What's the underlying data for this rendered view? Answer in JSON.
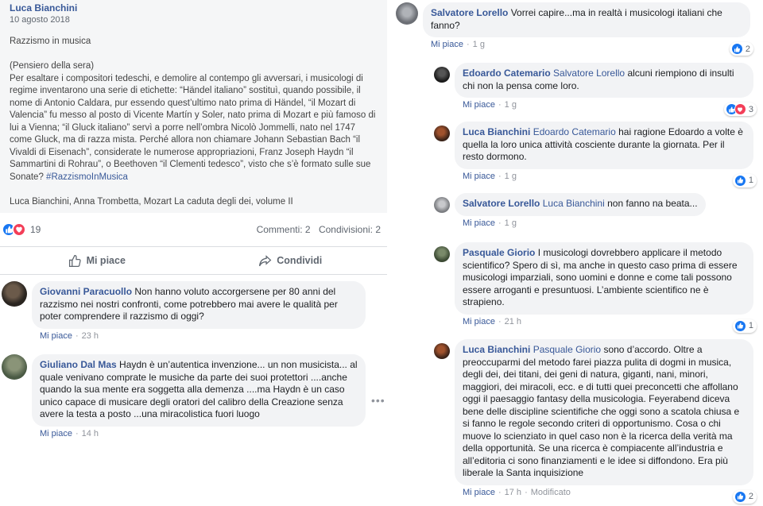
{
  "post": {
    "author": "Luca Bianchini",
    "date": "10 agosto 2018",
    "body": "Razzismo in musica\n\n(Pensiero della sera)\nPer esaltare i compositori tedeschi, e demolire al contempo gli avversari, i musicologi di regime inventarono una serie di etichette: “Händel italiano” sostituì, quando possibile, il nome di Antonio Caldara, pur essendo quest’ultimo nato prima di Händel, “il Mozart di Valencia” fu messo al posto di Vicente Martín y Soler, nato prima di Mozart e più famoso di lui a Vienna; “il Gluck italiano” servì a porre nell’ombra Nicolò Jommelli, nato nel 1747 come Gluck, ma di razza mista. Perché allora non chiamare Johann Sebastian Bach “il Vivaldi di Eisenach”, considerate le numerose appropriazioni, Franz Joseph Haydn “il Sammartini di Rohrau”, o Beethoven “il Clementi tedesco”, visto che s’è formato sulle sue Sonate? ",
    "hashtag": "#RazzismoInMusica",
    "source": "Luca Bianchini, Anna Trombetta, Mozart La caduta degli dei, volume II"
  },
  "stats": {
    "reaction_count": "19",
    "comments": "Commenti: 2",
    "shares": "Condivisioni: 2"
  },
  "actions": {
    "like": "Mi piace",
    "share": "Condividi"
  },
  "comments": [
    {
      "author": "Giovanni Paracuollo",
      "text": "Non hanno voluto accorgersene per 80 anni del razzismo nei nostri confronti, come potrebbero mai avere le qualità per poter comprendere il razzismo di oggi?",
      "like": "Mi piace",
      "time": "23 h"
    },
    {
      "author": "Giuliano Dal Mas",
      "text": "Haydn è un’autentica invenzione... un non musicista... al quale venivano comprate le musiche da parte dei suoi protettori ....anche quando la sua mente era soggetta alla demenza ....ma Haydn è un caso unico capace di musicare degli oratori del calibro della Creazione senza avere la testa a posto ...una miracolistica fuori luogo",
      "like": "Mi piace",
      "time": "14 h"
    },
    {
      "author": "Salvatore Lorello",
      "text": "Vorrei capire...ma in realtà i musicologi italiani che fanno?",
      "like": "Mi piace",
      "time": "1 g",
      "reactions": "2"
    },
    {
      "author": "Edoardo Catemario",
      "mention": "Salvatore Lorello",
      "text": "alcuni riempiono di insulti chi non la pensa come loro.",
      "like": "Mi piace",
      "time": "1 g",
      "reactions": "3"
    },
    {
      "author": "Luca Bianchini",
      "mention": "Edoardo Catemario",
      "text": "hai ragione Edoardo a volte è quella la loro unica attività cosciente durante la giornata. Per il resto dormono.",
      "like": "Mi piace",
      "time": "1 g",
      "reactions": "1"
    },
    {
      "author": "Salvatore Lorello",
      "mention": "Luca Bianchini",
      "text": "non fanno na beata...",
      "like": "Mi piace",
      "time": "1 g"
    },
    {
      "author": "Pasquale Giorio",
      "text": "I musicologi dovrebbero applicare il metodo scientifico? Spero di sì, ma anche in questo caso prima di essere musicologi imparziali, sono uomini e donne e come tali possono essere arroganti e presuntuosi. L’ambiente scientifico ne è strapieno.",
      "like": "Mi piace",
      "time": "21 h",
      "reactions": "1"
    },
    {
      "author": "Luca Bianchini",
      "mention": "Pasquale Giorio",
      "text": "sono d’accordo. Oltre a preoccuparmi del metodo farei piazza pulita di dogmi in musica, degli dei, dei titani, dei geni di natura, giganti, nani, minori, maggiori, dei miracoli, ecc. e di tutti quei preconcetti che affollano oggi il paesaggio fantasy della musicologia. Feyerabend diceva bene delle discipline scientifiche che oggi sono a scatola chiusa e si fanno le regole secondo criteri di opportunismo. Cosa o chi muove lo scienziato in quel caso non è la ricerca della verità ma della opportunità. Se una ricerca è compiacente all’industria e all’editoria ci sono finanziamenti e le idee si diffondono. Era più liberale la Santa inquisizione",
      "like": "Mi piace",
      "time": "17 h",
      "edited": "Modificato",
      "reactions": "2"
    }
  ],
  "colors": {
    "link": "#385898",
    "like_blue": "#1877f2",
    "love_red": "#f33e58",
    "bubble": "#f2f3f5"
  }
}
